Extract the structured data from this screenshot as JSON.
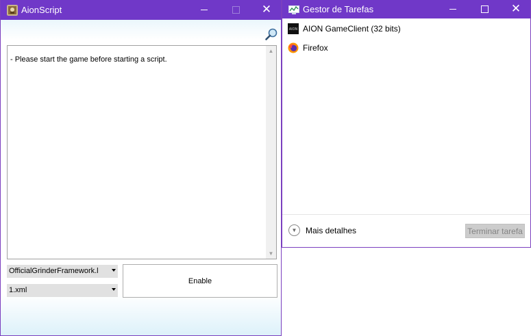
{
  "aion_window": {
    "title": "AionScript",
    "icon": "aion-app-icon",
    "log_text": "- Please start the game before starting a script.",
    "script_select_value": "OfficialGrinderFramework.l",
    "profile_select_value": "1.xml",
    "enable_label": "Enable",
    "search_icon": "magnifier-icon"
  },
  "task_manager": {
    "title": "Gestor de Tarefas",
    "processes": [
      {
        "name": "AION GameClient (32 bits)",
        "icon": "aion-client-icon"
      },
      {
        "name": "Firefox",
        "icon": "firefox-icon"
      }
    ],
    "more_details_label": "Mais detalhes",
    "end_task_label": "Terminar tarefa"
  },
  "colors": {
    "titlebar": "#7038c8",
    "accent_border": "#7b3fbf"
  }
}
